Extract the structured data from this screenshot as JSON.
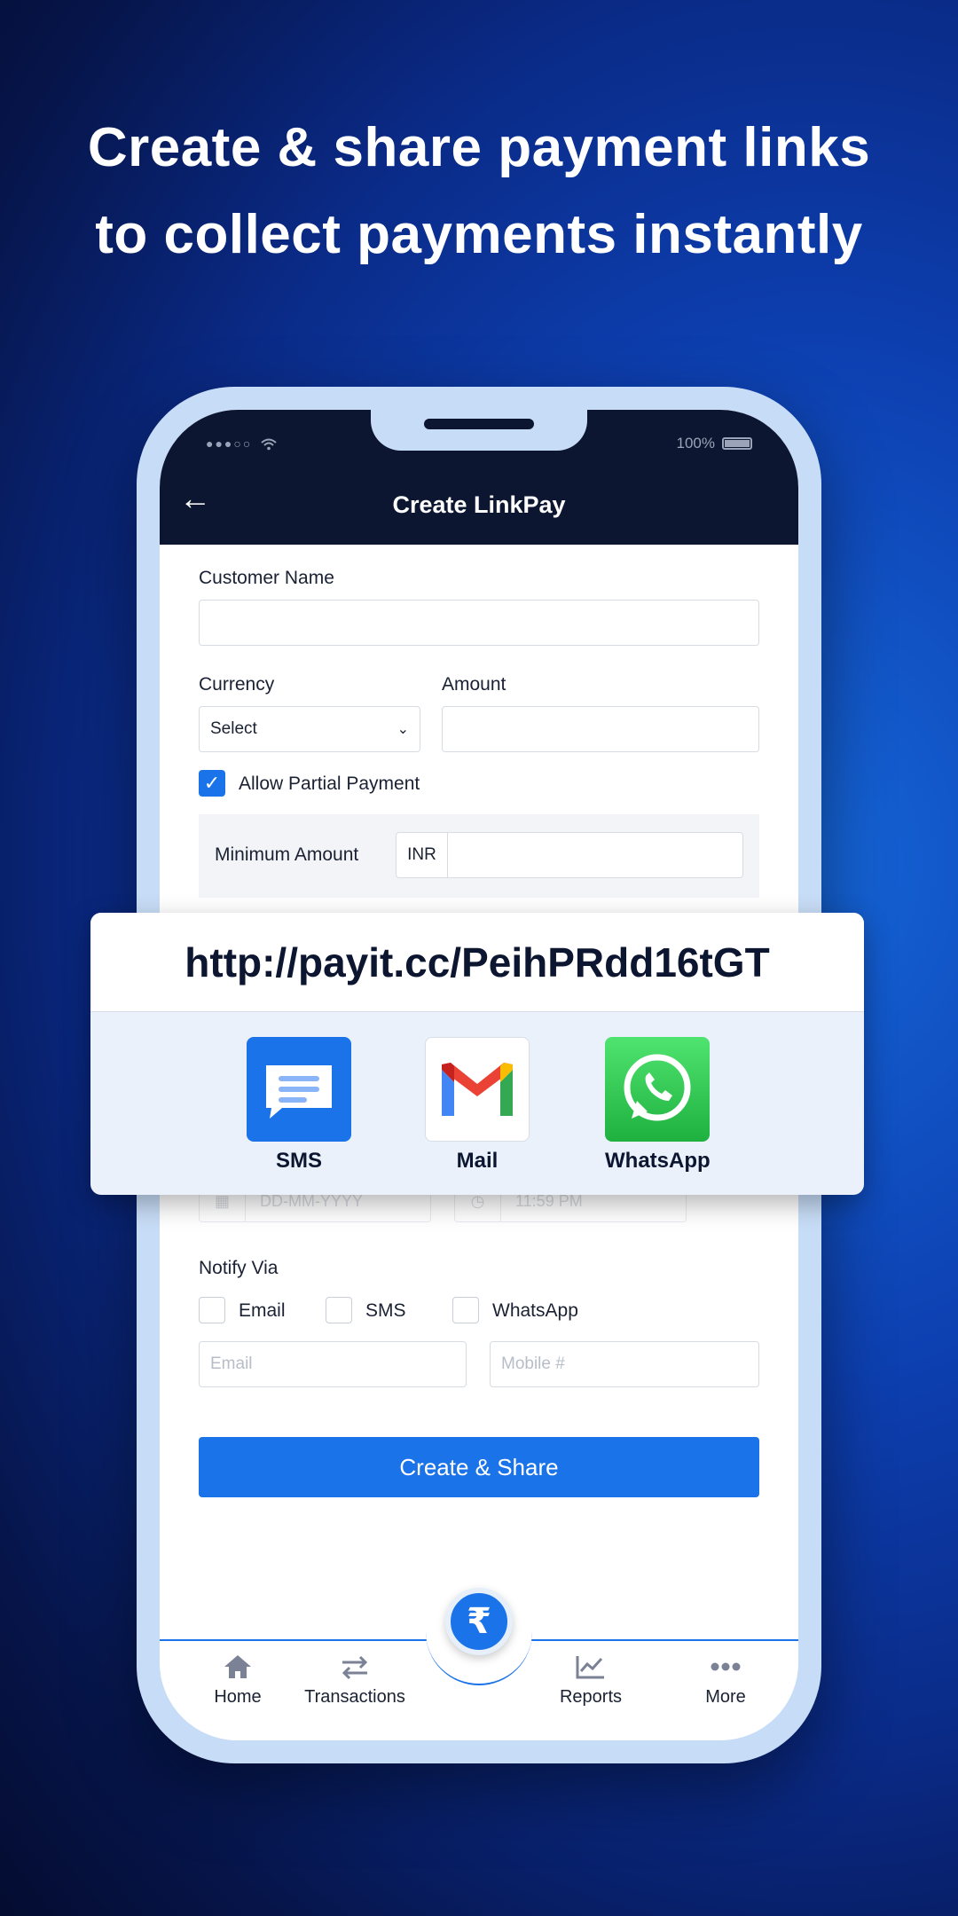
{
  "headline": {
    "line1": "Create & share payment links",
    "line2": "to collect payments instantly"
  },
  "status_bar": {
    "signal": "●●●○○",
    "battery": "100%"
  },
  "app_bar": {
    "back_icon": "←",
    "title": "Create LinkPay"
  },
  "form": {
    "customer_name_label": "Customer Name",
    "customer_name_value": "",
    "currency_label": "Currency",
    "currency_value": "Select",
    "amount_label": "Amount",
    "amount_value": "",
    "allow_partial_label": "Allow Partial Payment",
    "allow_partial_checked": true,
    "minimum_amount_label": "Minimum Amount",
    "minimum_currency": "INR",
    "date_placeholder": "DD-MM-YYYY",
    "time_placeholder": "11:59 PM",
    "notify_label": "Notify Via",
    "notify_options": [
      "Email",
      "SMS",
      "WhatsApp"
    ],
    "email_placeholder": "Email",
    "mobile_placeholder": "Mobile #",
    "submit_label": "Create & Share"
  },
  "share_card": {
    "link": "http://payit.cc/PeihPRdd16tGT",
    "apps": [
      {
        "label": "SMS",
        "icon": "sms-icon",
        "color": "#1a73e8"
      },
      {
        "label": "Mail",
        "icon": "gmail-icon",
        "color": "#ffffff"
      },
      {
        "label": "WhatsApp",
        "icon": "whatsapp-icon",
        "color": "#25d366"
      }
    ]
  },
  "bottom_nav": {
    "items": [
      {
        "label": "Home",
        "icon": "home-icon"
      },
      {
        "label": "Transactions",
        "icon": "transfer-icon"
      },
      {
        "label": "Reports",
        "icon": "chart-icon"
      },
      {
        "label": "More",
        "icon": "more-icon"
      }
    ],
    "fab_symbol": "₹"
  }
}
